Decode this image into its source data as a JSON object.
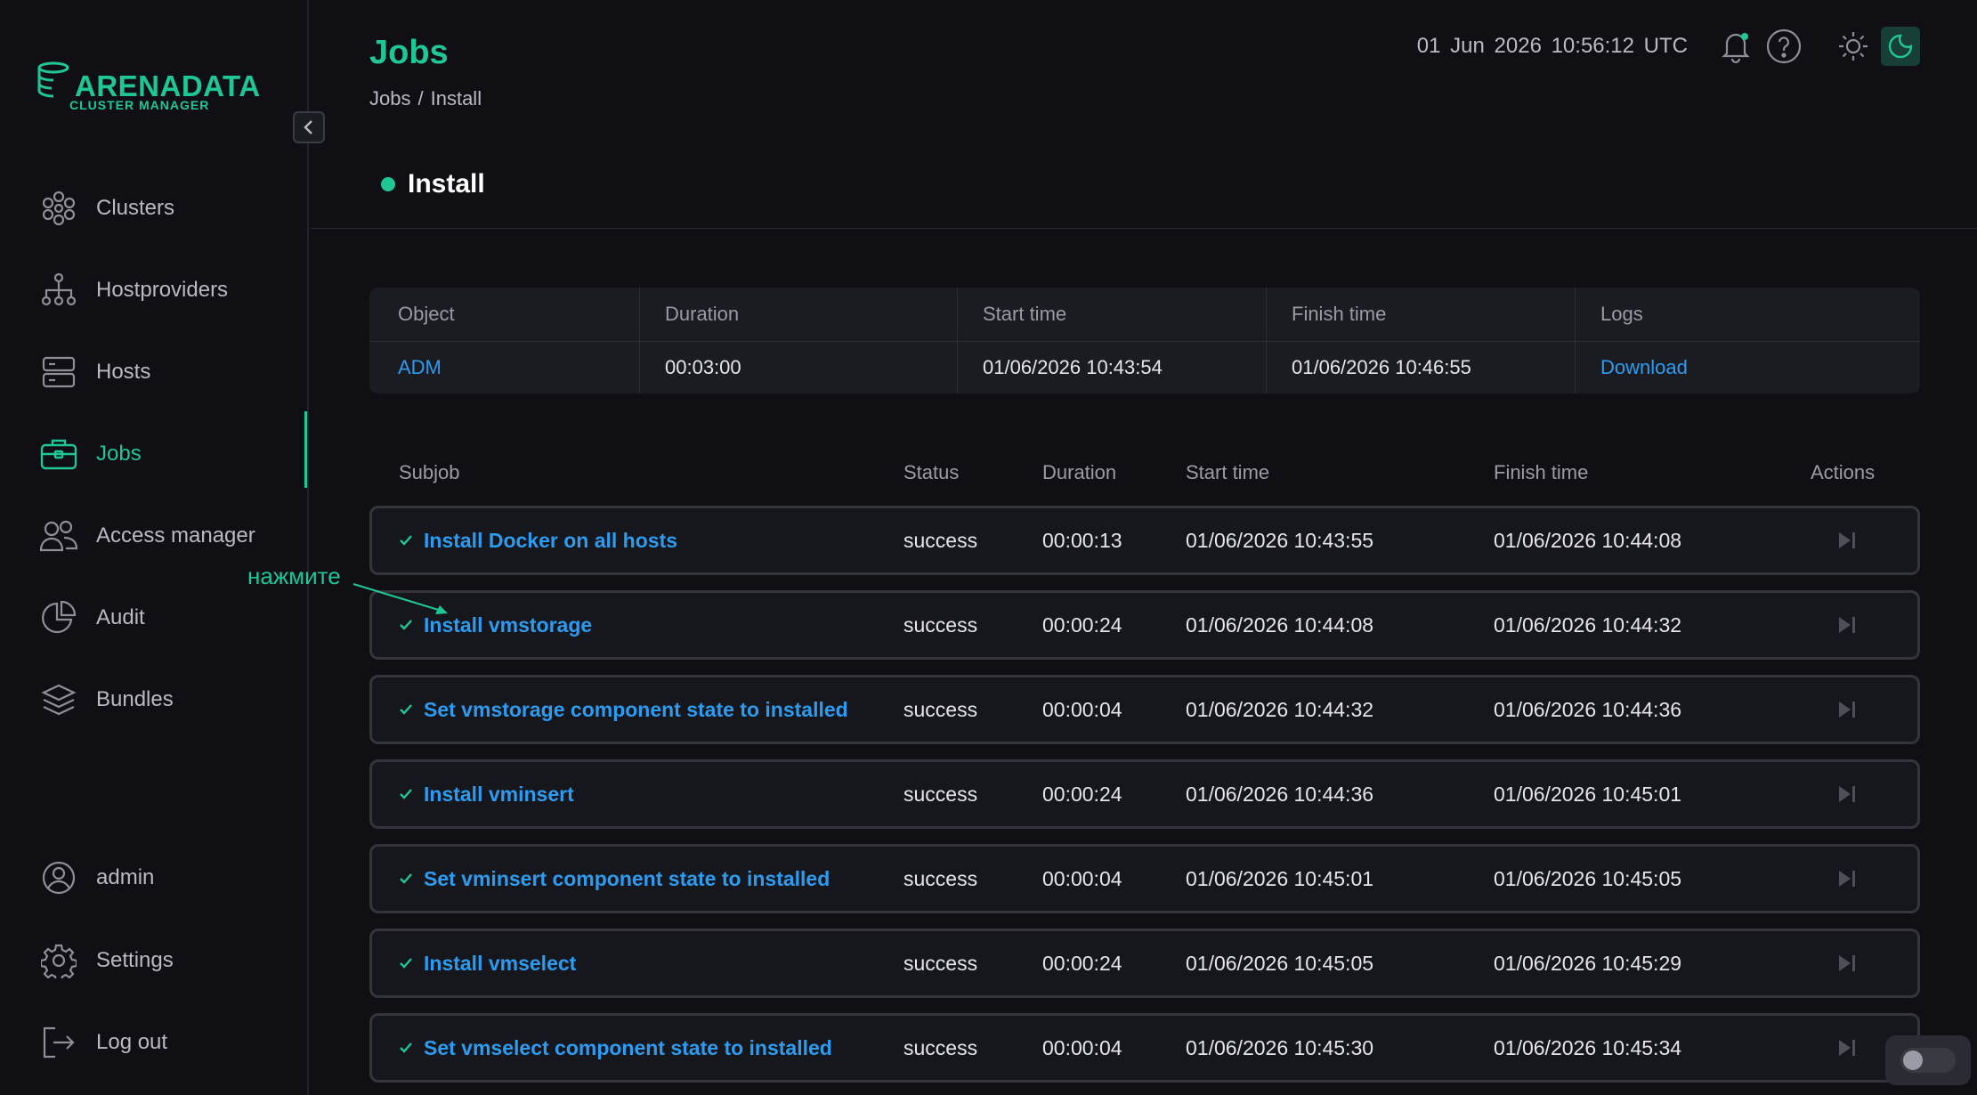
{
  "app": {
    "brand": "ARENADATA",
    "brand_sub": "CLUSTER MANAGER"
  },
  "colors": {
    "accent": "#1fc795",
    "link": "#2d9cf0",
    "background": "#101014",
    "surface": "#1b1c22"
  },
  "sidebar": {
    "collapse_icon": "chevron-left-icon",
    "items": [
      {
        "label": "Clusters",
        "icon": "clusters-icon",
        "active": false
      },
      {
        "label": "Hostproviders",
        "icon": "hierarchy-icon",
        "active": false
      },
      {
        "label": "Hosts",
        "icon": "server-icon",
        "active": false
      },
      {
        "label": "Jobs",
        "icon": "briefcase-icon",
        "active": true
      },
      {
        "label": "Access manager",
        "icon": "users-icon",
        "active": false
      },
      {
        "label": "Audit",
        "icon": "pie-chart-icon",
        "active": false
      },
      {
        "label": "Bundles",
        "icon": "layers-icon",
        "active": false
      }
    ],
    "bottom_items": [
      {
        "label": "admin",
        "icon": "user-circle-icon"
      },
      {
        "label": "Settings",
        "icon": "gear-icon"
      },
      {
        "label": "Log out",
        "icon": "logout-icon"
      }
    ]
  },
  "header": {
    "title": "Jobs",
    "breadcrumb": [
      "Jobs",
      "Install"
    ],
    "breadcrumb_sep": "/",
    "datetime": "01 Jun 2026  10:56:12  UTC",
    "icons": [
      "bell-icon",
      "help-icon",
      "sun-icon",
      "moon-icon"
    ]
  },
  "job": {
    "name": "Install",
    "status_color": "#1fc795"
  },
  "summary": {
    "headers": [
      "Object",
      "Duration",
      "Start time",
      "Finish time",
      "Logs"
    ],
    "row": {
      "object": "ADM",
      "duration": "00:03:00",
      "start": "01/06/2026 10:43:54",
      "finish": "01/06/2026 10:46:55",
      "logs": "Download"
    }
  },
  "subjobs": {
    "headers": [
      "Subjob",
      "Status",
      "Duration",
      "Start time",
      "Finish time",
      "Actions"
    ],
    "rows": [
      {
        "name": "Install Docker on all hosts",
        "status": "success",
        "duration": "00:00:13",
        "start": "01/06/2026 10:43:55",
        "finish": "01/06/2026 10:44:08"
      },
      {
        "name": "Install vmstorage",
        "status": "success",
        "duration": "00:00:24",
        "start": "01/06/2026 10:44:08",
        "finish": "01/06/2026 10:44:32"
      },
      {
        "name": "Set vmstorage component state to installed",
        "status": "success",
        "duration": "00:00:04",
        "start": "01/06/2026 10:44:32",
        "finish": "01/06/2026 10:44:36"
      },
      {
        "name": "Install vminsert",
        "status": "success",
        "duration": "00:00:24",
        "start": "01/06/2026 10:44:36",
        "finish": "01/06/2026 10:45:01"
      },
      {
        "name": "Set vminsert component state to installed",
        "status": "success",
        "duration": "00:00:04",
        "start": "01/06/2026 10:45:01",
        "finish": "01/06/2026 10:45:05"
      },
      {
        "name": "Install vmselect",
        "status": "success",
        "duration": "00:00:24",
        "start": "01/06/2026 10:45:05",
        "finish": "01/06/2026 10:45:29"
      },
      {
        "name": "Set vmselect component state to installed",
        "status": "success",
        "duration": "00:00:04",
        "start": "01/06/2026 10:45:30",
        "finish": "01/06/2026 10:45:34"
      }
    ]
  },
  "annotation": {
    "text": "нажмите"
  }
}
